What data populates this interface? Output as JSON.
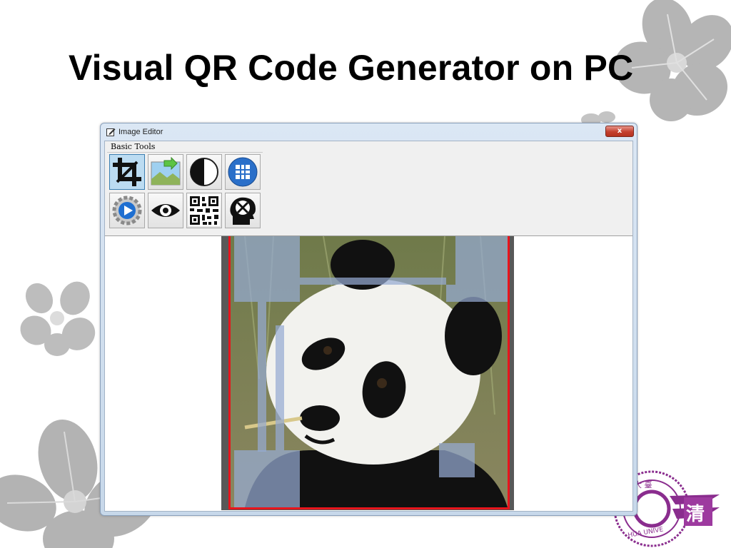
{
  "slide": {
    "title": "Visual QR Code Generator on PC"
  },
  "window": {
    "title": "Image Editor",
    "close_label": "x",
    "group_label": "Basic Tools"
  },
  "tools": [
    {
      "icon": "crop-icon",
      "active": true
    },
    {
      "icon": "landscape-image-icon",
      "active": false
    },
    {
      "icon": "contrast-icon",
      "active": false
    },
    {
      "icon": "grid-icon",
      "active": false
    },
    {
      "icon": "settings-gear-icon",
      "active": false
    },
    {
      "icon": "eye-icon",
      "active": false
    },
    {
      "icon": "qr-code-icon",
      "active": false
    },
    {
      "icon": "head-tools-icon",
      "active": false
    }
  ],
  "colors": {
    "frame_border": "#e8141c",
    "overlay": "#96aad2",
    "decor_gray": "#b9b9b9",
    "emblem_purple": "#8a2d8e"
  }
}
